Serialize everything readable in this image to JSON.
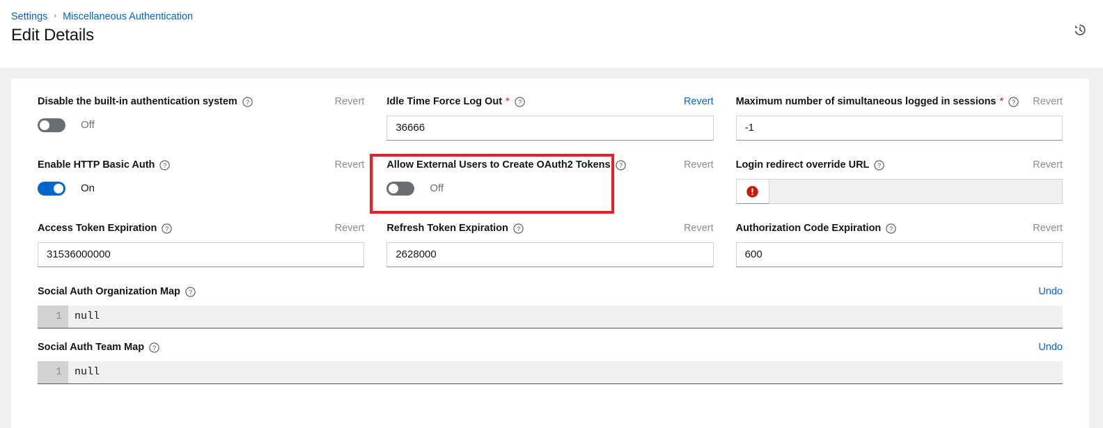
{
  "header": {
    "breadcrumb": [
      {
        "label": "Settings",
        "name": "breadcrumb-item-settings"
      },
      {
        "label": "Miscellaneous Authentication",
        "name": "breadcrumb-item-misc-auth"
      }
    ],
    "separator": "›",
    "title": "Edit Details",
    "history_icon": "history-icon"
  },
  "colors": {
    "link": "#0066cc",
    "accent": "#06c",
    "required": "#c9190b",
    "error": "#c9190b",
    "annotation": "#ee1c25",
    "page_bg": "#f0f0f0",
    "switch_off": "#6a6e73"
  },
  "labels": {
    "revert": "Revert",
    "undo": "Undo"
  },
  "fields": [
    {
      "name": "disable-builtin-auth",
      "label": "Disable the built-in authentication system",
      "required": false,
      "control": "switch",
      "value": "Off",
      "switch_on": false,
      "action_label": "Revert",
      "action_enabled": false
    },
    {
      "name": "idle-time-force-log-out",
      "label": "Idle Time Force Log Out",
      "required": true,
      "control": "text",
      "value": "36666",
      "action_label": "Revert",
      "action_enabled": true
    },
    {
      "name": "max-simultaneous-sessions",
      "label": "Maximum number of simultaneous logged in sessions",
      "required": true,
      "control": "text",
      "value": "-1",
      "action_label": "Revert",
      "action_enabled": false
    },
    {
      "name": "enable-http-basic-auth",
      "label": "Enable HTTP Basic Auth",
      "required": false,
      "control": "switch",
      "value": "On",
      "switch_on": true,
      "action_label": "Revert",
      "action_enabled": false
    },
    {
      "name": "allow-external-users-oauth2-tokens",
      "label": "Allow External Users to Create OAuth2 Tokens",
      "required": false,
      "control": "switch",
      "value": "Off",
      "switch_on": false,
      "action_label": "Revert",
      "action_enabled": false,
      "highlighted": true
    },
    {
      "name": "login-redirect-override-url",
      "label": "Login redirect override URL",
      "required": false,
      "control": "text-error",
      "value": "",
      "error_icon": "exclamation-circle-icon",
      "action_label": "Revert",
      "action_enabled": false
    },
    {
      "name": "access-token-expiration",
      "label": "Access Token Expiration",
      "required": false,
      "control": "text",
      "value": "31536000000",
      "action_label": "Revert",
      "action_enabled": false
    },
    {
      "name": "refresh-token-expiration",
      "label": "Refresh Token Expiration",
      "required": false,
      "control": "text",
      "value": "2628000",
      "action_label": "Revert",
      "action_enabled": false
    },
    {
      "name": "authorization-code-expiration",
      "label": "Authorization Code Expiration",
      "required": false,
      "control": "text",
      "value": "600",
      "action_label": "Revert",
      "action_enabled": false
    }
  ],
  "code_fields": [
    {
      "name": "social-auth-organization-map",
      "label": "Social Auth Organization Map",
      "action_label": "Undo",
      "line_number": "1",
      "value": "null"
    },
    {
      "name": "social-auth-team-map",
      "label": "Social Auth Team Map",
      "action_label": "Undo",
      "line_number": "1",
      "value": "null"
    }
  ]
}
